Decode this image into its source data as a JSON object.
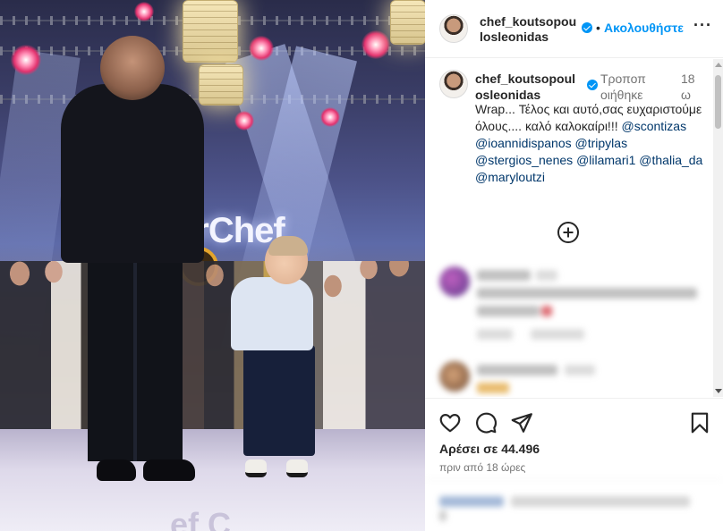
{
  "post": {
    "username_header": "chef_koutsopoulosleonidas",
    "follow_label": "Ακολουθήστε",
    "separator": "•",
    "more_label": "···"
  },
  "caption": {
    "username": "chef_koutsopoulosleonidas",
    "edited_label": "Τροποποιήθηκε",
    "time_label": "18 ω",
    "text": "Wrap... Τέλος και αυτό,σας ευχαριστούμε όλους.... καλό καλοκαίρι!!! ",
    "mentions": [
      "@scontizas",
      "@ioannidispanos",
      "@tripylas",
      "@stergios_nenes",
      "@lilamari1",
      "@thalia_da",
      "@maryloutzi"
    ]
  },
  "media": {
    "sign_text": "erChef",
    "floor_text": "ef C"
  },
  "footer": {
    "likes_label": "Αρέσει σε 44.496",
    "posted_ago": "πριν από 18 ώρες"
  },
  "icons": {
    "like": "heart-icon",
    "comment": "comment-icon",
    "share": "send-icon",
    "save": "bookmark-icon",
    "more": "more-horizontal-icon",
    "verified": "verified-badge-icon",
    "load_more": "plus-circle-icon"
  },
  "colors": {
    "accent": "#0095f6",
    "mention": "#00376b",
    "muted": "#737373",
    "text": "#262626"
  }
}
